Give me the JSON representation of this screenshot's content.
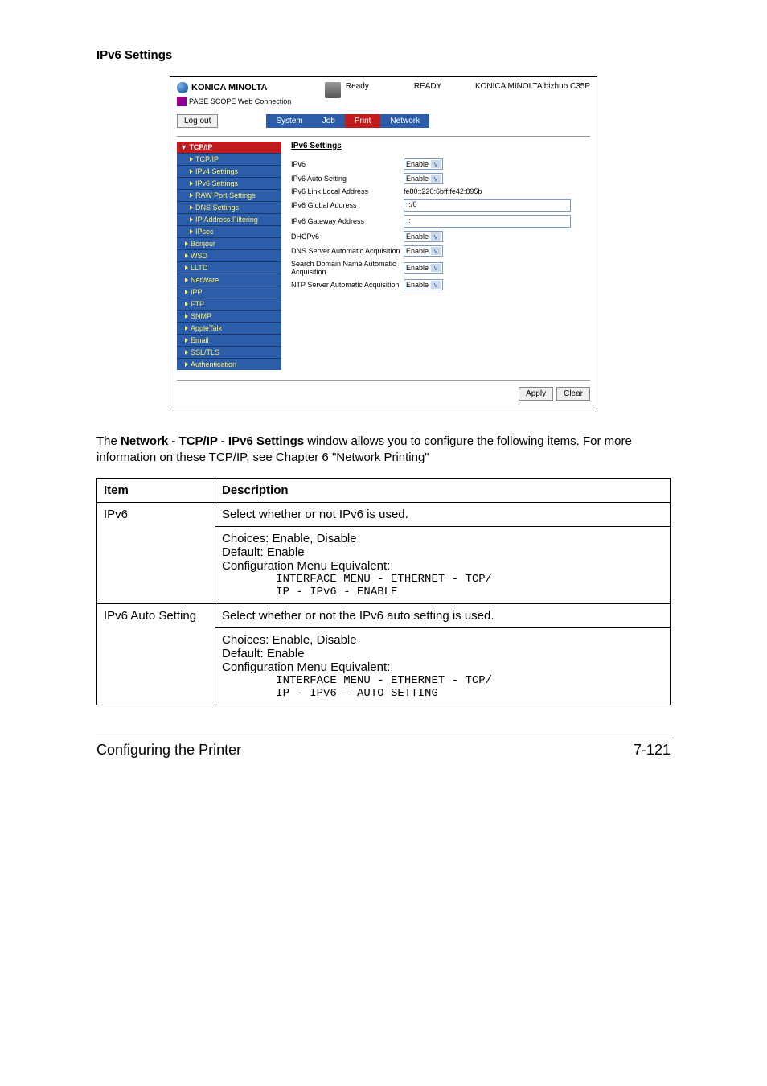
{
  "section_heading": "IPv6 Settings",
  "screenshot": {
    "brand": "KONICA MINOLTA",
    "sublogo": "PAGE SCOPE Web Connection",
    "status_icon_label": "Ready",
    "status_text": "READY",
    "device_name": "KONICA MINOLTA bizhub C35P",
    "logout_btn": "Log out",
    "tabs": [
      "System",
      "Job",
      "Print",
      "Network"
    ],
    "sidebar": {
      "header": "▼ TCP/IP",
      "items": [
        "TCP/IP",
        "IPv4 Settings",
        "IPv6 Settings",
        "RAW Port Settings",
        "DNS Settings",
        "IP Address Filtering",
        "IPsec",
        "Bonjour",
        "WSD",
        "LLTD",
        "NetWare",
        "IPP",
        "FTP",
        "SNMP",
        "AppleTalk",
        "Email",
        "SSL/TLS",
        "Authentication"
      ]
    },
    "main": {
      "title": "IPv6 Settings",
      "fields": {
        "ipv6_label": "IPv6",
        "ipv6_value": "Enable",
        "auto_label": "IPv6 Auto Setting",
        "auto_value": "Enable",
        "link_local_label": "IPv6 Link Local Address",
        "link_local_value": "fe80::220:6bff:fe42:895b",
        "global_label": "IPv6 Global Address",
        "global_value": "::/0",
        "gateway_label": "IPv6 Gateway Address",
        "gateway_value": "::",
        "dhcpv6_label": "DHCPv6",
        "dhcpv6_value": "Enable",
        "dns_auto_label": "DNS Server Automatic Acquisition",
        "dns_auto_value": "Enable",
        "domain_auto_label": "Search Domain Name Automatic Acquisition",
        "domain_auto_value": "Enable",
        "ntp_auto_label": "NTP Server Automatic Acquisition",
        "ntp_auto_value": "Enable"
      },
      "apply_btn": "Apply",
      "clear_btn": "Clear"
    }
  },
  "paragraph": {
    "pre": "The ",
    "bold": "Network - TCP/IP - IPv6 Settings",
    "post": " window allows you to configure the following items. For more information on these TCP/IP, see Chapter 6 \"Network Printing\""
  },
  "table": {
    "head_item": "Item",
    "head_desc": "Description",
    "rows": [
      {
        "item": "IPv6",
        "desc_line": "Select whether or not IPv6 is used.",
        "choices": "Choices: Enable, Disable",
        "default": "Default:  Enable",
        "equiv_label": "Configuration Menu Equivalent:",
        "equiv_code1": "        INTERFACE MENU - ETHERNET - TCP/",
        "equiv_code2": "        IP - IPv6 - ENABLE"
      },
      {
        "item": "IPv6 Auto Setting",
        "desc_line": "Select whether or not the IPv6 auto setting is used.",
        "choices": "Choices: Enable, Disable",
        "default": "Default:  Enable",
        "equiv_label": "Configuration Menu Equivalent:",
        "equiv_code1": "        INTERFACE MENU - ETHERNET - TCP/",
        "equiv_code2": "        IP - IPv6 - AUTO SETTING"
      }
    ]
  },
  "footer": {
    "left": "Configuring the Printer",
    "right": "7-121"
  }
}
